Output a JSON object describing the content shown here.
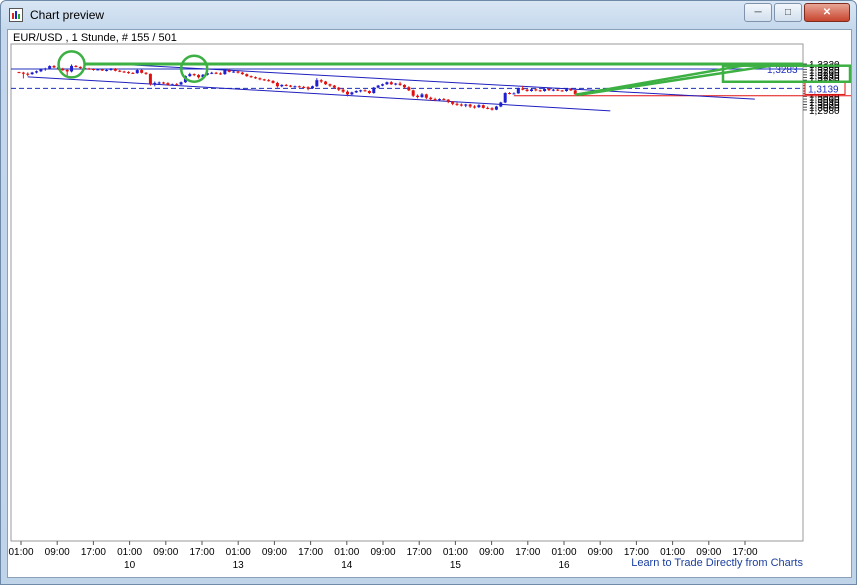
{
  "window": {
    "title": "Chart preview",
    "buttons": [
      "minimize",
      "maximize",
      "close"
    ]
  },
  "chart_data": {
    "type": "candlestick",
    "title": "EUR/USD , 1 Stunde, # 155 / 501",
    "ylim": [
      1.296,
      1.333
    ],
    "y_ticks": [
      "1,3320",
      "1,3300",
      "1,3280",
      "1,3260",
      "1,3240",
      "1,3220",
      "1,3200",
      "1,3180",
      "1,3160",
      "1,3140",
      "1,3120",
      "1,3100",
      "1,3080",
      "1,3060",
      "1,3040",
      "1,3020",
      "1,3000",
      "1,2980"
    ],
    "y_tick_values": [
      1.332,
      1.33,
      1.328,
      1.326,
      1.324,
      1.322,
      1.32,
      1.318,
      1.316,
      1.314,
      1.312,
      1.31,
      1.308,
      1.306,
      1.304,
      1.302,
      1.3,
      1.298
    ],
    "x_time_labels": [
      "01:00",
      "09:00",
      "17:00",
      "01:00",
      "09:00",
      "17:00",
      "01:00",
      "09:00",
      "17:00",
      "01:00",
      "09:00",
      "17:00",
      "01:00",
      "09:00",
      "17:00",
      "01:00",
      "09:00",
      "17:00",
      "01:00",
      "09:00",
      "17:00"
    ],
    "x_date_labels": [
      {
        "label": "10",
        "at_index": 3
      },
      {
        "label": "13",
        "at_index": 6
      },
      {
        "label": "14",
        "at_index": 9
      },
      {
        "label": "15",
        "at_index": 12
      },
      {
        "label": "16",
        "at_index": 15
      }
    ],
    "price_labels": [
      {
        "value": 1.3283,
        "text": "1,3283",
        "color": "#1f2fbf",
        "style": "solid"
      },
      {
        "value": 1.3139,
        "text": "1,3139",
        "color": "#1f2fbf",
        "style": "dashed",
        "boxed": true
      }
    ],
    "red_level": 1.3085,
    "footer_link": "Learn to Trade Directly from Charts",
    "colors": {
      "bull": "#1f1fcf",
      "bear": "#e01010",
      "channel": "#1f1fbf",
      "annotation": "#3cb043",
      "grid": "#dcdcdc"
    },
    "channel": {
      "upper": [
        {
          "i": 26,
          "y": 1.3313
        },
        {
          "i": 168,
          "y": 1.306
        }
      ],
      "lower": [
        {
          "i": 2,
          "y": 1.3225
        },
        {
          "i": 135,
          "y": 1.2973
        }
      ]
    },
    "annotations": {
      "resistance": 1.332,
      "circles": [
        {
          "i": 12,
          "y": 1.3317
        },
        {
          "i": 40,
          "y": 1.3285
        }
      ],
      "target_box": [
        1.327,
        1.33
      ]
    },
    "candles": [
      [
        1.326,
        1.3263,
        1.3252,
        1.3256
      ],
      [
        1.3256,
        1.3262,
        1.3213,
        1.3248
      ],
      [
        1.3248,
        1.3258,
        1.323,
        1.3245
      ],
      [
        1.3245,
        1.3262,
        1.324,
        1.3257
      ],
      [
        1.3257,
        1.3272,
        1.325,
        1.3266
      ],
      [
        1.3266,
        1.3285,
        1.326,
        1.328
      ],
      [
        1.328,
        1.3292,
        1.327,
        1.3287
      ],
      [
        1.3287,
        1.331,
        1.328,
        1.3305
      ],
      [
        1.3305,
        1.3312,
        1.329,
        1.3295
      ],
      [
        1.3295,
        1.3298,
        1.3275,
        1.3282
      ],
      [
        1.3282,
        1.3292,
        1.327,
        1.3276
      ],
      [
        1.3276,
        1.328,
        1.3235,
        1.3265
      ],
      [
        1.3265,
        1.3317,
        1.3258,
        1.3306
      ],
      [
        1.3306,
        1.3312,
        1.3295,
        1.3298
      ],
      [
        1.3298,
        1.3303,
        1.3285,
        1.329
      ],
      [
        1.329,
        1.3295,
        1.328,
        1.3286
      ],
      [
        1.3286,
        1.3292,
        1.3278,
        1.3283
      ],
      [
        1.3283,
        1.3288,
        1.327,
        1.3278
      ],
      [
        1.3278,
        1.3285,
        1.3272,
        1.328
      ],
      [
        1.328,
        1.3283,
        1.3268,
        1.3272
      ],
      [
        1.3272,
        1.328,
        1.3265,
        1.3276
      ],
      [
        1.3276,
        1.329,
        1.327,
        1.3286
      ],
      [
        1.3286,
        1.329,
        1.3265,
        1.327
      ],
      [
        1.327,
        1.3276,
        1.326,
        1.3264
      ],
      [
        1.3264,
        1.327,
        1.3255,
        1.326
      ],
      [
        1.326,
        1.3266,
        1.3248,
        1.3254
      ],
      [
        1.3254,
        1.326,
        1.3247,
        1.3252
      ],
      [
        1.3252,
        1.3279,
        1.3248,
        1.3275
      ],
      [
        1.3275,
        1.328,
        1.325,
        1.3255
      ],
      [
        1.3255,
        1.326,
        1.324,
        1.3247
      ],
      [
        1.3247,
        1.325,
        1.316,
        1.3175
      ],
      [
        1.3175,
        1.319,
        1.3155,
        1.318
      ],
      [
        1.318,
        1.319,
        1.317,
        1.3183
      ],
      [
        1.3183,
        1.3188,
        1.3172,
        1.3178
      ],
      [
        1.3178,
        1.3185,
        1.316,
        1.3165
      ],
      [
        1.3165,
        1.3175,
        1.3162,
        1.317
      ],
      [
        1.317,
        1.3178,
        1.3164,
        1.3168
      ],
      [
        1.3168,
        1.319,
        1.3165,
        1.3185
      ],
      [
        1.3185,
        1.3235,
        1.318,
        1.323
      ],
      [
        1.323,
        1.3255,
        1.3225,
        1.3245
      ],
      [
        1.3245,
        1.325,
        1.323,
        1.3238
      ],
      [
        1.3238,
        1.3245,
        1.3212,
        1.3222
      ],
      [
        1.3222,
        1.3246,
        1.3218,
        1.324
      ],
      [
        1.324,
        1.3258,
        1.3235,
        1.3252
      ],
      [
        1.3252,
        1.3262,
        1.3245,
        1.3255
      ],
      [
        1.3255,
        1.3262,
        1.3245,
        1.325
      ],
      [
        1.325,
        1.3258,
        1.324,
        1.3245
      ],
      [
        1.3245,
        1.3278,
        1.324,
        1.3272
      ],
      [
        1.3272,
        1.3285,
        1.3258,
        1.3262
      ],
      [
        1.3262,
        1.3268,
        1.3255,
        1.3264
      ],
      [
        1.3264,
        1.3268,
        1.325,
        1.3256
      ],
      [
        1.3256,
        1.3262,
        1.324,
        1.3245
      ],
      [
        1.3245,
        1.325,
        1.3225,
        1.323
      ],
      [
        1.323,
        1.3235,
        1.3218,
        1.3222
      ],
      [
        1.3222,
        1.3228,
        1.321,
        1.3214
      ],
      [
        1.3214,
        1.322,
        1.32,
        1.3206
      ],
      [
        1.3206,
        1.321,
        1.3195,
        1.32
      ],
      [
        1.32,
        1.3208,
        1.319,
        1.3195
      ],
      [
        1.3195,
        1.32,
        1.3175,
        1.318
      ],
      [
        1.318,
        1.3188,
        1.3145,
        1.3155
      ],
      [
        1.3155,
        1.317,
        1.3148,
        1.3165
      ],
      [
        1.3165,
        1.3172,
        1.3155,
        1.316
      ],
      [
        1.316,
        1.3165,
        1.3148,
        1.3152
      ],
      [
        1.3152,
        1.316,
        1.3145,
        1.3155
      ],
      [
        1.3155,
        1.316,
        1.3145,
        1.315
      ],
      [
        1.315,
        1.3158,
        1.314,
        1.3148
      ],
      [
        1.3148,
        1.3155,
        1.3125,
        1.314
      ],
      [
        1.314,
        1.316,
        1.3135,
        1.3155
      ],
      [
        1.3155,
        1.3215,
        1.315,
        1.32
      ],
      [
        1.32,
        1.3208,
        1.318,
        1.319
      ],
      [
        1.319,
        1.3195,
        1.3165,
        1.317
      ],
      [
        1.317,
        1.3175,
        1.315,
        1.316
      ],
      [
        1.316,
        1.3165,
        1.314,
        1.3145
      ],
      [
        1.3145,
        1.315,
        1.312,
        1.313
      ],
      [
        1.313,
        1.314,
        1.3105,
        1.3115
      ],
      [
        1.3115,
        1.3125,
        1.308,
        1.3095
      ],
      [
        1.3095,
        1.3115,
        1.309,
        1.311
      ],
      [
        1.311,
        1.3125,
        1.3105,
        1.312
      ],
      [
        1.312,
        1.313,
        1.311,
        1.3125
      ],
      [
        1.3125,
        1.3132,
        1.3115,
        1.312
      ],
      [
        1.312,
        1.3125,
        1.3098,
        1.3105
      ],
      [
        1.3105,
        1.315,
        1.31,
        1.3145
      ],
      [
        1.3145,
        1.3165,
        1.314,
        1.316
      ],
      [
        1.316,
        1.3175,
        1.3155,
        1.317
      ],
      [
        1.317,
        1.319,
        1.3165,
        1.3185
      ],
      [
        1.3185,
        1.3193,
        1.3165,
        1.317
      ],
      [
        1.317,
        1.318,
        1.3162,
        1.3175
      ],
      [
        1.3175,
        1.3188,
        1.3158,
        1.3165
      ],
      [
        1.3165,
        1.317,
        1.314,
        1.3148
      ],
      [
        1.3148,
        1.3155,
        1.312,
        1.3125
      ],
      [
        1.3125,
        1.313,
        1.3075,
        1.3085
      ],
      [
        1.3085,
        1.3095,
        1.3065,
        1.3075
      ],
      [
        1.3075,
        1.3105,
        1.307,
        1.3095
      ],
      [
        1.3095,
        1.31,
        1.306,
        1.307
      ],
      [
        1.307,
        1.3078,
        1.305,
        1.306
      ],
      [
        1.306,
        1.307,
        1.3045,
        1.3055
      ],
      [
        1.3055,
        1.3065,
        1.305,
        1.306
      ],
      [
        1.306,
        1.3068,
        1.3052,
        1.3056
      ],
      [
        1.3056,
        1.306,
        1.303,
        1.304
      ],
      [
        1.304,
        1.3045,
        1.3015,
        1.3025
      ],
      [
        1.3025,
        1.3035,
        1.301,
        1.302
      ],
      [
        1.302,
        1.3028,
        1.3005,
        1.3012
      ],
      [
        1.3012,
        1.3025,
        1.3,
        1.302
      ],
      [
        1.302,
        1.3025,
        1.2995,
        1.3005
      ],
      [
        1.3005,
        1.3015,
        1.299,
        1.3
      ],
      [
        1.3,
        1.3022,
        1.2995,
        1.3015
      ],
      [
        1.3015,
        1.302,
        1.299,
        1.2995
      ],
      [
        1.2995,
        1.3005,
        1.2985,
        1.2992
      ],
      [
        1.2992,
        1.3,
        1.2975,
        1.2982
      ],
      [
        1.2982,
        1.301,
        1.2978,
        1.3005
      ],
      [
        1.3005,
        1.304,
        1.3,
        1.3035
      ],
      [
        1.3035,
        1.311,
        1.303,
        1.3105
      ],
      [
        1.3105,
        1.3112,
        1.3095,
        1.31
      ],
      [
        1.31,
        1.311,
        1.3098,
        1.3102
      ],
      [
        1.3102,
        1.3145,
        1.31,
        1.3138
      ],
      [
        1.3138,
        1.3158,
        1.3125,
        1.313
      ],
      [
        1.313,
        1.3135,
        1.3115,
        1.312
      ],
      [
        1.312,
        1.314,
        1.3115,
        1.3132
      ],
      [
        1.3132,
        1.3142,
        1.3118,
        1.3125
      ],
      [
        1.3125,
        1.313,
        1.3115,
        1.312
      ],
      [
        1.312,
        1.3142,
        1.3115,
        1.3135
      ],
      [
        1.3135,
        1.314,
        1.312,
        1.3126
      ],
      [
        1.3126,
        1.3135,
        1.3118,
        1.313
      ],
      [
        1.313,
        1.3135,
        1.312,
        1.3124
      ],
      [
        1.3124,
        1.3128,
        1.3115,
        1.312
      ],
      [
        1.312,
        1.3138,
        1.3115,
        1.3132
      ],
      [
        1.3132,
        1.314,
        1.312,
        1.3125
      ],
      [
        1.3125,
        1.3128,
        1.3092,
        1.3095
      ]
    ]
  }
}
